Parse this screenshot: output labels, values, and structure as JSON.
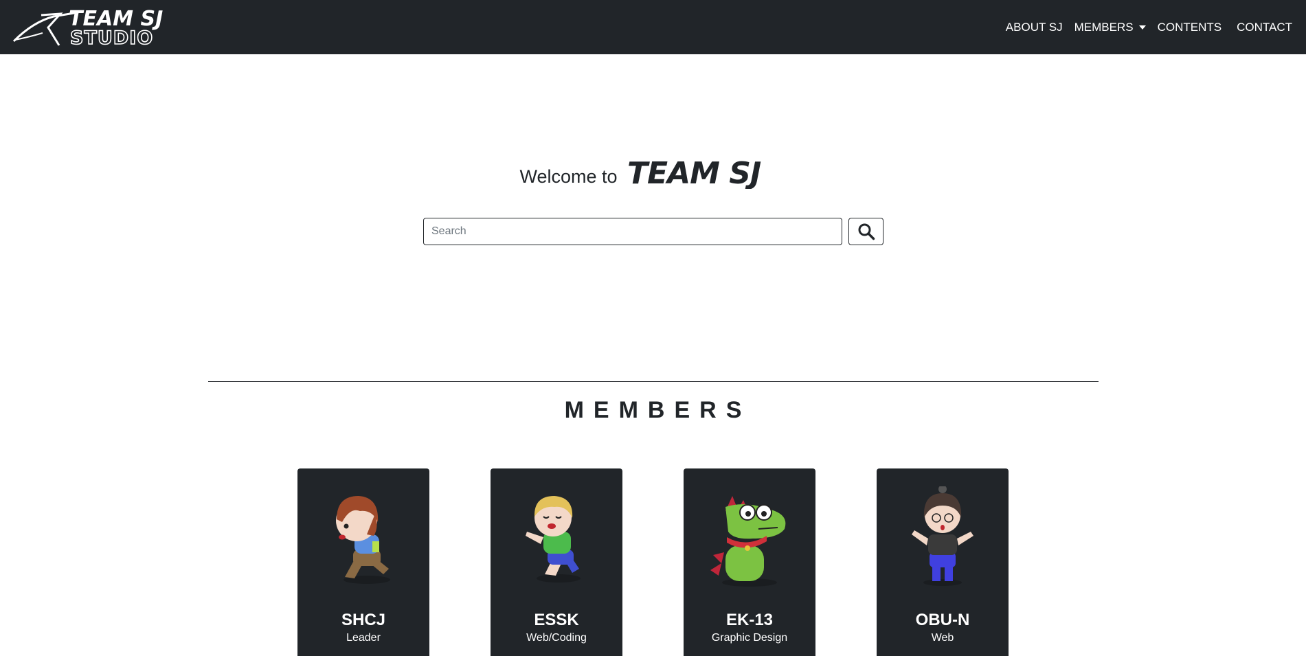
{
  "header": {
    "brand_logo_text": "TEAM SJ STUDIO",
    "nav": [
      {
        "label": "ABOUT SJ"
      },
      {
        "label": "MEMBERS",
        "has_dropdown": true
      },
      {
        "label": "CONTENTS"
      },
      {
        "label": "CONTACT"
      }
    ]
  },
  "hero": {
    "welcome_text": "Welcome to",
    "logo_text": "TEAM SJ"
  },
  "search": {
    "placeholder": "Search",
    "value": "",
    "button_icon": "search-icon"
  },
  "members": {
    "title": "MEMBERS",
    "cards": [
      {
        "name": "SHCJ",
        "role": "Leader",
        "avatar": "chibi-runner-brown-hair"
      },
      {
        "name": "ESSK",
        "role": "Web/Coding",
        "avatar": "chibi-crying-blond"
      },
      {
        "name": "EK-13",
        "role": "Graphic Design",
        "avatar": "green-dinosaur"
      },
      {
        "name": "OBU-N",
        "role": "Web",
        "avatar": "chibi-glasses-bun"
      }
    ]
  },
  "colors": {
    "navbar_bg": "#212529",
    "card_bg": "#212529",
    "text_dark": "#212529",
    "text_light": "#ffffff",
    "dino_green": "#7cc242"
  }
}
